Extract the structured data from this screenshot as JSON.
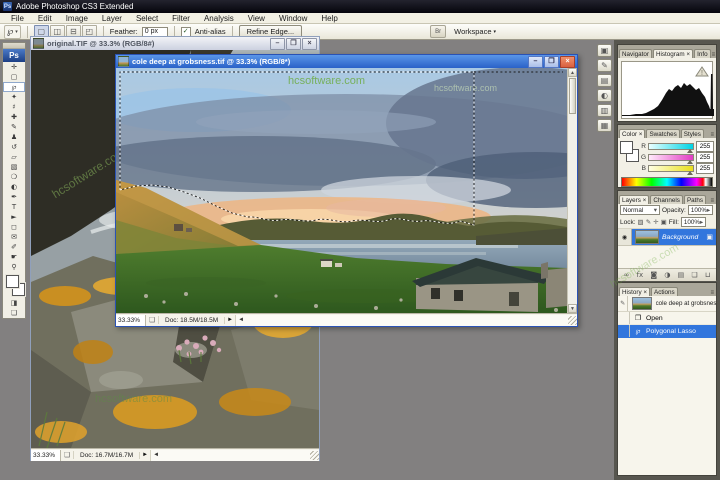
{
  "titlebar": {
    "ps_badge": "Ps",
    "app_title": "Adobe Photoshop CS3 Extended"
  },
  "menu": {
    "items": [
      "File",
      "Edit",
      "Image",
      "Layer",
      "Select",
      "Filter",
      "Analysis",
      "View",
      "Window",
      "Help"
    ]
  },
  "options": {
    "active_tool_glyph": "℘",
    "dropdown_glyph": "▾",
    "combine_buttons": [
      {
        "name": "new-selection-icon",
        "glyph": "▢"
      },
      {
        "name": "add-to-selection-icon",
        "glyph": "◫"
      },
      {
        "name": "subtract-from-selection-icon",
        "glyph": "⊟"
      },
      {
        "name": "intersect-selection-icon",
        "glyph": "◰"
      }
    ],
    "feather_label": "Feather:",
    "feather_value": "0 px",
    "check_glyph": "✓",
    "antialias_label": "Anti-alias",
    "refine_edge_label": "Refine Edge...",
    "bridge_glyph": "Br",
    "workspace_label": "Workspace"
  },
  "toolbox": {
    "logo": "Ps",
    "tools": [
      {
        "name": "move-tool",
        "glyph": "✛"
      },
      {
        "name": "rectangular-marquee-tool",
        "glyph": "▢"
      },
      {
        "name": "polygonal-lasso-tool",
        "glyph": "℘",
        "active": true
      },
      {
        "name": "magic-wand-tool",
        "glyph": "✦"
      },
      {
        "name": "crop-tool",
        "glyph": "♯"
      },
      {
        "name": "healing-brush-tool",
        "glyph": "✚"
      },
      {
        "name": "brush-tool",
        "glyph": "✎"
      },
      {
        "name": "clone-stamp-tool",
        "glyph": "♟"
      },
      {
        "name": "history-brush-tool",
        "glyph": "↺"
      },
      {
        "name": "eraser-tool",
        "glyph": "▱"
      },
      {
        "name": "gradient-tool",
        "glyph": "▧"
      },
      {
        "name": "blur-tool",
        "glyph": "❍"
      },
      {
        "name": "dodge-tool",
        "glyph": "◐"
      },
      {
        "name": "pen-tool",
        "glyph": "✒"
      },
      {
        "name": "type-tool",
        "glyph": "T"
      },
      {
        "name": "path-selection-tool",
        "glyph": "►"
      },
      {
        "name": "shape-tool",
        "glyph": "◻"
      },
      {
        "name": "notes-tool",
        "glyph": "✉"
      },
      {
        "name": "eyedropper-tool",
        "glyph": "✐"
      },
      {
        "name": "hand-tool",
        "glyph": "☛"
      },
      {
        "name": "zoom-tool",
        "glyph": "⚲"
      }
    ],
    "quick_mask_glyph": "◨",
    "screen_mode_glyph": "❏"
  },
  "dock_icons": [
    {
      "name": "dock-palette-icon-1",
      "glyph": "▣"
    },
    {
      "name": "dock-palette-icon-2",
      "glyph": "✎"
    },
    {
      "name": "dock-palette-icon-3",
      "glyph": "▤"
    },
    {
      "name": "dock-palette-icon-4",
      "glyph": "◐"
    },
    {
      "name": "dock-palette-icon-5",
      "glyph": "▥"
    },
    {
      "name": "dock-palette-icon-6",
      "glyph": "▦"
    }
  ],
  "windows": {
    "back": {
      "title": "original.TIF @ 33.3% (RGB/8#)",
      "zoom": "33.33%",
      "doc": "Doc: 16.7M/16.7M",
      "controls": {
        "min": "–",
        "max": "❒",
        "close": "×"
      }
    },
    "front": {
      "title": "cole deep at grobsness.tif @ 33.3% (RGB/8*)",
      "zoom": "33.33%",
      "doc": "Doc: 18.5M/18.5M",
      "controls": {
        "min": "–",
        "max": "❒",
        "close": "×"
      }
    }
  },
  "watermark": "hcsoftware.com",
  "panels": {
    "navigator": {
      "tabs": [
        "Navigator",
        "Histogram ×",
        "Info"
      ],
      "warning_glyph": "!"
    },
    "color": {
      "tabs": [
        "Color ×",
        "Swatches",
        "Styles"
      ],
      "channels": [
        {
          "label": "R",
          "value": "255"
        },
        {
          "label": "G",
          "value": "255"
        },
        {
          "label": "B",
          "value": "255"
        }
      ]
    },
    "layers": {
      "tabs": [
        "Layers ×",
        "Channels",
        "Paths"
      ],
      "blend_mode": "Normal",
      "opacity_label": "Opacity:",
      "opacity_value": "100%",
      "lock_label": "Lock:",
      "fill_label": "Fill:",
      "fill_value": "100%",
      "layer_name": "Background",
      "lock_icons": [
        {
          "name": "lock-transparency-icon",
          "glyph": "▨"
        },
        {
          "name": "lock-pixels-icon",
          "glyph": "✎"
        },
        {
          "name": "lock-position-icon",
          "glyph": "✛"
        },
        {
          "name": "lock-all-icon",
          "glyph": "▣"
        }
      ],
      "bottom_icons": [
        {
          "name": "link-layers-icon",
          "glyph": "∞"
        },
        {
          "name": "layer-style-icon",
          "glyph": "fx"
        },
        {
          "name": "add-layer-mask-icon",
          "glyph": "◙"
        },
        {
          "name": "adjustment-layer-icon",
          "glyph": "◑"
        },
        {
          "name": "new-group-icon",
          "glyph": "▤"
        },
        {
          "name": "new-layer-icon",
          "glyph": "❏"
        },
        {
          "name": "delete-layer-icon",
          "glyph": "⊔"
        }
      ]
    },
    "history": {
      "tabs": [
        "History ×",
        "Actions"
      ],
      "snapshot_name": "cole deep at grobsness.tif",
      "items": [
        {
          "name": "history-item-open",
          "label": "Open",
          "glyph": "❐",
          "selected": false
        },
        {
          "name": "history-item-polygonal-lasso",
          "label": "Polygonal Lasso",
          "glyph": "℘",
          "selected": true
        }
      ]
    }
  },
  "colors": {
    "selection_blue": "#3276dd",
    "titlebar_active_top": "#5a96e8",
    "titlebar_active_bottom": "#2a62c8",
    "close_button": "#d96040",
    "watermark_green": "#6aaa3a"
  }
}
